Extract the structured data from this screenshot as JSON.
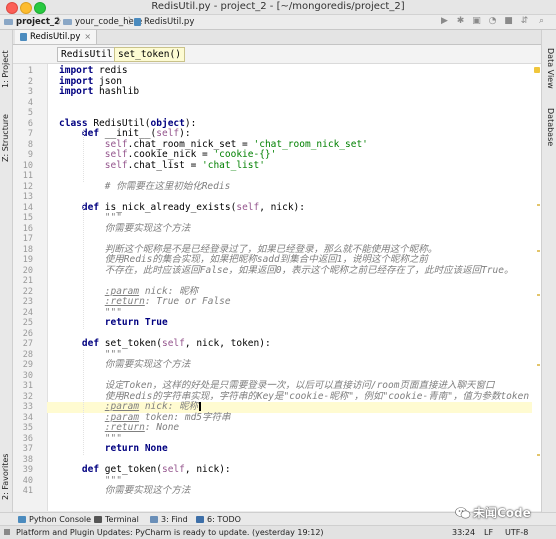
{
  "window": {
    "title": "RedisUtil.py - project_2 - [~/mongoredis/project_2]"
  },
  "nav": {
    "crumbs": [
      {
        "label": "project_2",
        "icon": "folder-icon"
      },
      {
        "label": "your_code_here",
        "icon": "folder-icon"
      },
      {
        "label": "RedisUtil.py",
        "icon": "python-file-icon"
      }
    ],
    "tools": [
      "run-icon",
      "debug-icon",
      "coverage-icon",
      "stop-icon",
      "search-icon"
    ]
  },
  "left_tools": {
    "project": "1: Project",
    "structure": "Z: Structure",
    "favorites": "2: Favorites"
  },
  "right_tools": {
    "data_view": "Data View",
    "database": "Database"
  },
  "tab": {
    "label": "RedisUtil.py",
    "close": "×"
  },
  "structure": {
    "class_name": "RedisUtil",
    "method_name": "set_token()"
  },
  "editor": {
    "current_line": 33,
    "lines": [
      "import redis",
      "import json",
      "import hashlib",
      "",
      "",
      "class RedisUtil(object):",
      "    def __init__(self):",
      "        self.chat_room_nick_set = 'chat_room_nick_set'",
      "        self.cookie_nick = 'cookie-{}'",
      "        self.chat_list = 'chat_list'",
      "",
      "        # 你需要在这里初始化Redis",
      "",
      "    def is_nick_already_exists(self, nick):",
      "        \"\"\"",
      "        你需要实现这个方法",
      "",
      "        判断这个昵称是不是已经登录过了，如果已经登录，那么就不能使用这个昵称。",
      "        使用Redis的集合实现，如果把昵称sadd到集合中返回1，说明这个昵称之前",
      "        不存在，此时应该返回False，如果返回0，表示这个昵称之前已经存在了，此时应该返回True。",
      "",
      "        :param nick: 昵称",
      "        :return: True or False",
      "        \"\"\"",
      "        return True",
      "",
      "    def set_token(self, nick, token):",
      "        \"\"\"",
      "        你需要实现这个方法",
      "",
      "        设定Token，这样的好处是只需要登录一次，以后可以直接访问/room页面直接进入聊天窗口",
      "        使用Redis的字符串实现，字符串的Key是\"cookie-昵称\"，例如\"cookie-青南\"，值为参数token",
      "        :param nick: 昵称",
      "        :param token: md5字符串",
      "        :return: None",
      "        \"\"\"",
      "        return None",
      "",
      "    def get_token(self, nick):",
      "        \"\"\"",
      "        你需要实现这个方法"
    ]
  },
  "bottom_tools": [
    {
      "label": "Python Console",
      "icon": "python-console-icon"
    },
    {
      "label": "Terminal",
      "icon": "terminal-icon"
    },
    {
      "label": "3: Find",
      "icon": "find-icon"
    },
    {
      "label": "6: TODO",
      "icon": "todo-icon"
    }
  ],
  "status": {
    "message": "Platform and Plugin Updates: PyCharm is ready to update. (yesterday 19:12)",
    "position": "33:24",
    "line_sep": "LF",
    "encoding": "UTF-8"
  },
  "watermark": {
    "text": "未闻Code"
  },
  "colors": {
    "keyword": "#000080",
    "string": "#008000",
    "comment": "#808080",
    "self": "#94558d",
    "current_line": "#fffbd1"
  }
}
